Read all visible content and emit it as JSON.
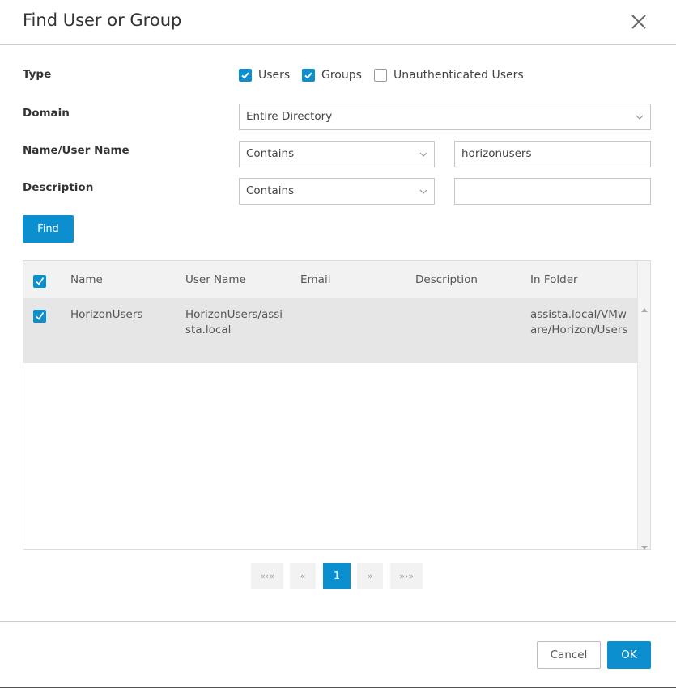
{
  "dialog": {
    "title": "Find User or Group"
  },
  "form": {
    "type_label": "Type",
    "type_options": [
      {
        "label": "Users",
        "checked": true
      },
      {
        "label": "Groups",
        "checked": true
      },
      {
        "label": "Unauthenticated Users",
        "checked": false
      }
    ],
    "domain_label": "Domain",
    "domain_value": "Entire Directory",
    "name_label": "Name/User Name",
    "name_operator": "Contains",
    "name_value": "horizonusers",
    "description_label": "Description",
    "description_operator": "Contains",
    "description_value": "",
    "find_button": "Find"
  },
  "results": {
    "columns": [
      "Name",
      "User Name",
      "Email",
      "Description",
      "In Folder"
    ],
    "select_all_checked": true,
    "rows": [
      {
        "checked": true,
        "name": "HorizonUsers",
        "user_name": "HorizonUsers/assista.local",
        "email": "",
        "description": "",
        "in_folder": "assista.local/VMware/Horizon/Users"
      }
    ]
  },
  "pagination": {
    "first": "«‹«",
    "prev": "«",
    "current": "1",
    "next": "»",
    "last": "»›»"
  },
  "footer": {
    "cancel_label": "Cancel",
    "ok_label": "OK"
  },
  "colors": {
    "accent": "#0c8fcf",
    "row_selected": "#e6e6e6",
    "header_bg": "#f2f2f2"
  }
}
